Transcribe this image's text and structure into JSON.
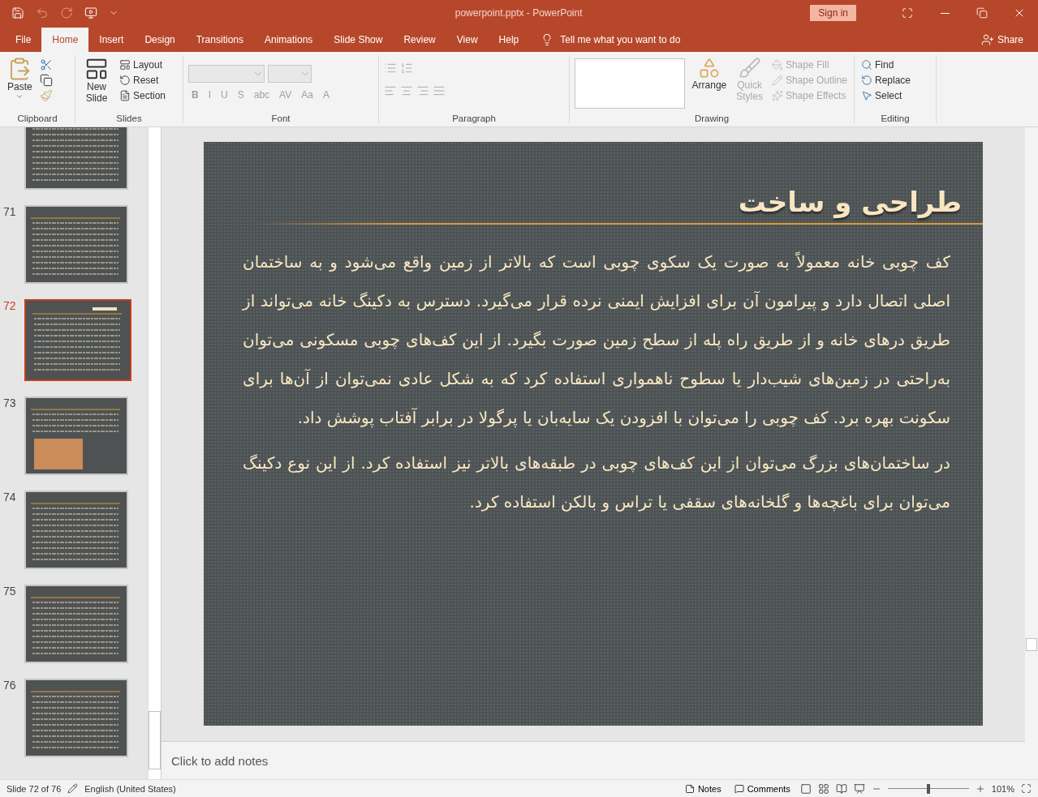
{
  "window": {
    "title": "powerpoint.pptx  -  PowerPoint",
    "sign_in": "Sign in"
  },
  "tabs": [
    {
      "label": "File",
      "selected": false
    },
    {
      "label": "Home",
      "selected": true
    },
    {
      "label": "Insert",
      "selected": false
    },
    {
      "label": "Design",
      "selected": false
    },
    {
      "label": "Transitions",
      "selected": false
    },
    {
      "label": "Animations",
      "selected": false
    },
    {
      "label": "Slide Show",
      "selected": false
    },
    {
      "label": "Review",
      "selected": false
    },
    {
      "label": "View",
      "selected": false
    },
    {
      "label": "Help",
      "selected": false
    }
  ],
  "tell_me": "Tell me what you want to do",
  "share": "Share",
  "ribbon": {
    "clipboard": {
      "label": "Clipboard",
      "paste": "Paste"
    },
    "slides": {
      "label": "Slides",
      "new_slide": "New Slide",
      "items": [
        {
          "label": "Layout"
        },
        {
          "label": "Reset"
        },
        {
          "label": "Section"
        }
      ]
    },
    "font": {
      "label": "Font",
      "tools": [
        "B",
        "I",
        "U",
        "S",
        "abc",
        "AV",
        "Aa",
        "A"
      ],
      "disabled": true
    },
    "paragraph": {
      "label": "Paragraph",
      "disabled": true
    },
    "drawing": {
      "label": "Drawing",
      "arrange": "Arrange",
      "quick_styles": "Quick Styles",
      "items": [
        {
          "label": "Shape Fill",
          "disabled": true
        },
        {
          "label": "Shape Outline",
          "disabled": true
        },
        {
          "label": "Shape Effects",
          "disabled": true
        }
      ]
    },
    "editing": {
      "label": "Editing",
      "items": [
        {
          "kind": "find",
          "label": "Find"
        },
        {
          "kind": "replace",
          "label": "Replace"
        },
        {
          "kind": "select",
          "label": "Select"
        }
      ]
    }
  },
  "thumbnails": [
    {
      "kind": "text",
      "selected": false
    },
    {
      "number": "71",
      "kind": "text",
      "selected": false
    },
    {
      "number": "72",
      "kind": "title",
      "selected": true
    },
    {
      "number": "73",
      "kind": "photo",
      "selected": false
    },
    {
      "number": "74",
      "kind": "text",
      "selected": false
    },
    {
      "number": "75",
      "kind": "text",
      "selected": false
    },
    {
      "number": "76",
      "kind": "text",
      "selected": false
    }
  ],
  "slide": {
    "title": "طراحی و ساخت",
    "paragraphs": [
      "کف چوبی خانه معمولاً به صورت یک سکوی چوبی است که بالاتر از زمین واقع می‌شود و به ساختمان اصلی اتصال دارد و پیرامون آن برای افزایش ایمنی نرده قرار می‌گیرد. دسترس به دکینگ خانه می‌تواند از طریق درهای خانه و از طریق راه پله از سطح زمین صورت بگیرد. از این کف‌های چوبی مسکونی می‌توان به‌راحتی در زمین‌های شیب‌دار یا سطوح ناهمواری استفاده کرد که به شکل عادی نمی‌توان از آن‌ها برای سکونت بهره برد. کف چوبی را می‌توان با افزودن یک سایه‌بان یا پرگولا در برابر آفتاب پوشش داد.",
      "در ساختمان‌های بزرگ می‌توان از این کف‌های چوبی در طبقه‌های بالاتر نیز استفاده کرد. از این نوع دکینگ می‌توان برای باغچه‌ها و گلخانه‌های سقفی یا تراس و بالکن استفاده کرد."
    ]
  },
  "notes": {
    "placeholder": "Click to add notes"
  },
  "status_bar": {
    "slide_info": "Slide 72 of 76",
    "language": "English (United States)",
    "notes": "Notes",
    "comments": "Comments",
    "zoom": {
      "level": 0.5
    },
    "zoom_text": "101%"
  }
}
